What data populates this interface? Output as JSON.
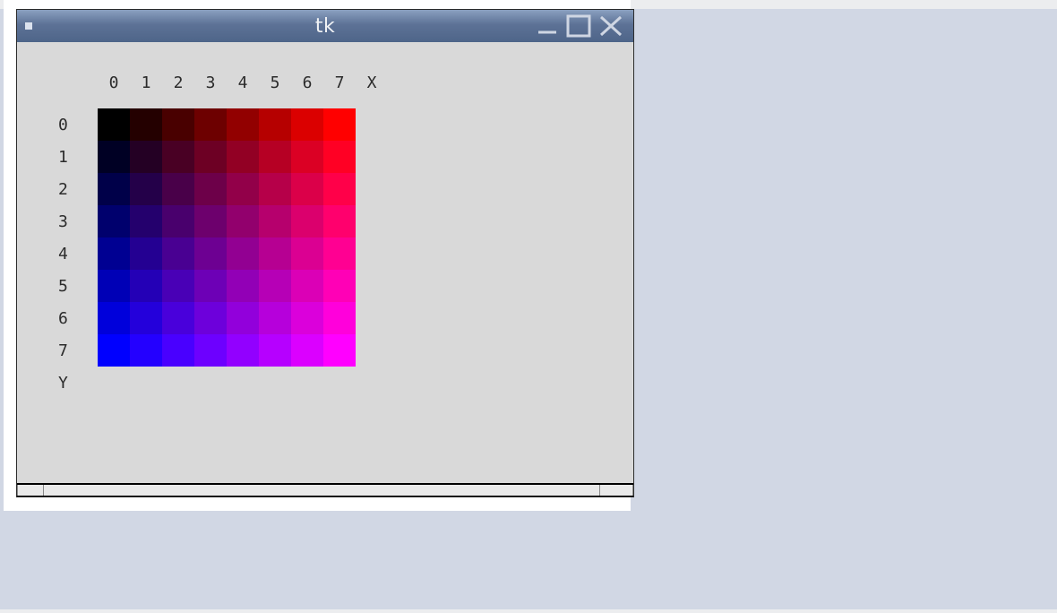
{
  "window": {
    "title": "tk"
  },
  "grid": {
    "col_headers": [
      "0",
      "1",
      "2",
      "3",
      "4",
      "5",
      "6",
      "7",
      "X"
    ],
    "row_headers": [
      "0",
      "1",
      "2",
      "3",
      "4",
      "5",
      "6",
      "7",
      "Y"
    ],
    "size": 8
  },
  "chart_data": {
    "type": "heatmap",
    "title": "",
    "xlabel": "X",
    "ylabel": "Y",
    "x_ticks": [
      0,
      1,
      2,
      3,
      4,
      5,
      6,
      7
    ],
    "y_ticks": [
      0,
      1,
      2,
      3,
      4,
      5,
      6,
      7
    ],
    "color_formula": "rgb = (col/7*255, 0, row/7*255)",
    "cells": [
      [
        [
          0,
          0,
          0
        ],
        [
          36,
          0,
          0
        ],
        [
          73,
          0,
          0
        ],
        [
          109,
          0,
          0
        ],
        [
          146,
          0,
          0
        ],
        [
          182,
          0,
          0
        ],
        [
          219,
          0,
          0
        ],
        [
          255,
          0,
          0
        ]
      ],
      [
        [
          0,
          0,
          36
        ],
        [
          36,
          0,
          36
        ],
        [
          73,
          0,
          36
        ],
        [
          109,
          0,
          36
        ],
        [
          146,
          0,
          36
        ],
        [
          182,
          0,
          36
        ],
        [
          219,
          0,
          36
        ],
        [
          255,
          0,
          36
        ]
      ],
      [
        [
          0,
          0,
          73
        ],
        [
          36,
          0,
          73
        ],
        [
          73,
          0,
          73
        ],
        [
          109,
          0,
          73
        ],
        [
          146,
          0,
          73
        ],
        [
          182,
          0,
          73
        ],
        [
          219,
          0,
          73
        ],
        [
          255,
          0,
          73
        ]
      ],
      [
        [
          0,
          0,
          109
        ],
        [
          36,
          0,
          109
        ],
        [
          73,
          0,
          109
        ],
        [
          109,
          0,
          109
        ],
        [
          146,
          0,
          109
        ],
        [
          182,
          0,
          109
        ],
        [
          219,
          0,
          109
        ],
        [
          255,
          0,
          109
        ]
      ],
      [
        [
          0,
          0,
          146
        ],
        [
          36,
          0,
          146
        ],
        [
          73,
          0,
          146
        ],
        [
          109,
          0,
          146
        ],
        [
          146,
          0,
          146
        ],
        [
          182,
          0,
          146
        ],
        [
          219,
          0,
          146
        ],
        [
          255,
          0,
          146
        ]
      ],
      [
        [
          0,
          0,
          182
        ],
        [
          36,
          0,
          182
        ],
        [
          73,
          0,
          182
        ],
        [
          109,
          0,
          182
        ],
        [
          146,
          0,
          182
        ],
        [
          182,
          0,
          182
        ],
        [
          219,
          0,
          182
        ],
        [
          255,
          0,
          182
        ]
      ],
      [
        [
          0,
          0,
          219
        ],
        [
          36,
          0,
          219
        ],
        [
          73,
          0,
          219
        ],
        [
          109,
          0,
          219
        ],
        [
          146,
          0,
          219
        ],
        [
          182,
          0,
          219
        ],
        [
          219,
          0,
          219
        ],
        [
          255,
          0,
          219
        ]
      ],
      [
        [
          0,
          0,
          255
        ],
        [
          36,
          0,
          255
        ],
        [
          73,
          0,
          255
        ],
        [
          109,
          0,
          255
        ],
        [
          146,
          0,
          255
        ],
        [
          182,
          0,
          255
        ],
        [
          219,
          0,
          255
        ],
        [
          255,
          0,
          255
        ]
      ]
    ]
  }
}
